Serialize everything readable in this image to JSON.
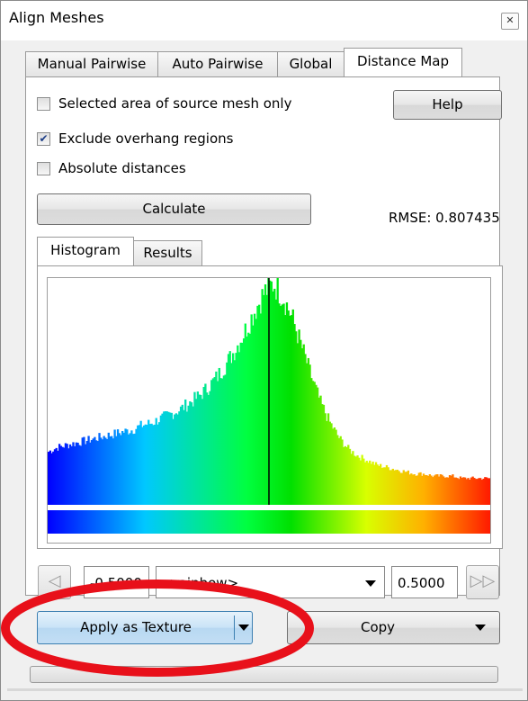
{
  "window": {
    "title": "Align Meshes"
  },
  "tabs": [
    "Manual Pairwise",
    "Auto Pairwise",
    "Global",
    "Distance Map"
  ],
  "active_tab": "Distance Map",
  "options": {
    "selected_area_label": "Selected area of source mesh only",
    "selected_area_checked": false,
    "exclude_overhang_label": "Exclude overhang regions",
    "exclude_overhang_checked": true,
    "absolute_distances_label": "Absolute distances",
    "absolute_distances_checked": false
  },
  "buttons": {
    "help": "Help",
    "calculate": "Calculate",
    "apply_texture": "Apply as Texture",
    "copy": "Copy"
  },
  "rmse": "RMSE: 0.807435",
  "subtabs": [
    "Histogram",
    "Results"
  ],
  "active_subtab": "Histogram",
  "range": {
    "min": "-0.5000",
    "max": "0.5000",
    "colormap": "<rainbow>"
  },
  "colors": {
    "annotation_circle": "#e8101a",
    "check_mark": "#1c3d86"
  },
  "chart_data": {
    "type": "histogram",
    "colormap": "rainbow",
    "x_range": [
      -0.5,
      0.5
    ],
    "marker_x": 0.0,
    "relative_heights": [
      0.24,
      0.26,
      0.27,
      0.28,
      0.29,
      0.3,
      0.31,
      0.32,
      0.33,
      0.34,
      0.36,
      0.37,
      0.39,
      0.41,
      0.43,
      0.46,
      0.49,
      0.53,
      0.58,
      0.64,
      0.71,
      0.79,
      0.88,
      0.96,
      1.0,
      0.94,
      0.84,
      0.71,
      0.58,
      0.46,
      0.37,
      0.3,
      0.25,
      0.22,
      0.2,
      0.18,
      0.17,
      0.16,
      0.15,
      0.14,
      0.14,
      0.13,
      0.13,
      0.13,
      0.12,
      0.12,
      0.12,
      0.12
    ]
  }
}
